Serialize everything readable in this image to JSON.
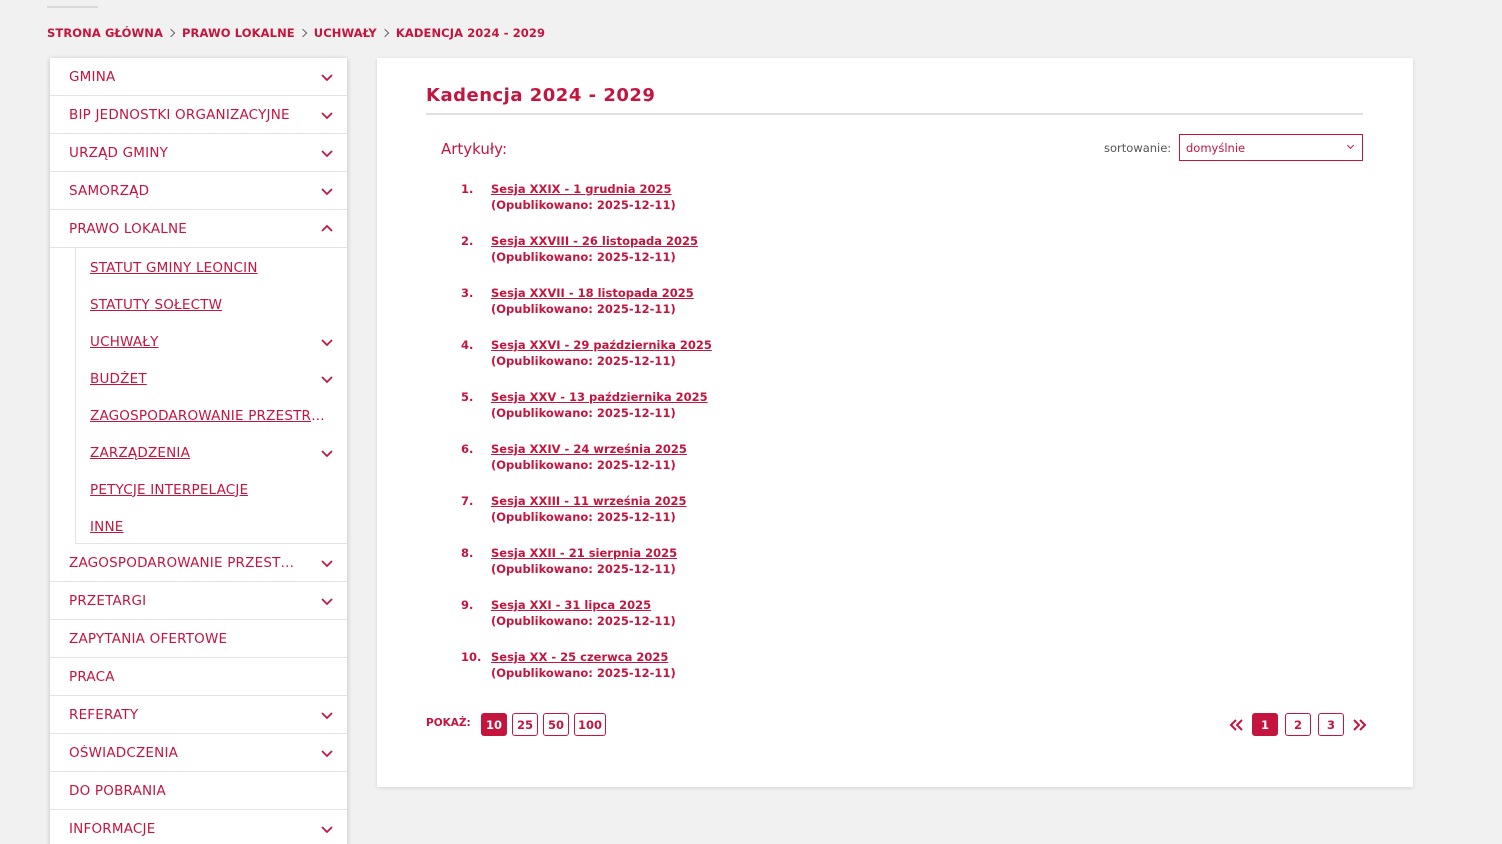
{
  "breadcrumb": [
    "STRONA GŁÓWNA",
    "PRAWO LOKALNE",
    "UCHWAŁY",
    "KADENCJA 2024 - 2029"
  ],
  "sidebar": {
    "items_top": [
      {
        "label": "GMINA",
        "chevron": "down"
      },
      {
        "label": "BIP JEDNOSTKI ORGANIZACYJNE",
        "chevron": "down"
      },
      {
        "label": "URZĄD GMINY",
        "chevron": "down"
      },
      {
        "label": "SAMORZĄD",
        "chevron": "down"
      },
      {
        "label": "PRAWO LOKALNE",
        "chevron": "up"
      }
    ],
    "subitems": [
      {
        "label": "STATUT GMINY LEONCIN",
        "chevron": "none"
      },
      {
        "label": "STATUTY SOŁECTW",
        "chevron": "none"
      },
      {
        "label": "UCHWAŁY",
        "chevron": "down"
      },
      {
        "label": "BUDŻET",
        "chevron": "down"
      },
      {
        "label": "ZAGOSPODAROWANIE PRZESTRZE...",
        "chevron": "none"
      },
      {
        "label": "ZARZĄDZENIA",
        "chevron": "down"
      },
      {
        "label": "PETYCJE INTERPELACJE",
        "chevron": "none"
      },
      {
        "label": "INNE",
        "chevron": "none"
      }
    ],
    "items_bottom": [
      {
        "label": "ZAGOSPODAROWANIE PRZESTRZ...",
        "chevron": "down"
      },
      {
        "label": "PRZETARGI",
        "chevron": "down"
      },
      {
        "label": "ZAPYTANIA OFERTOWE",
        "chevron": "none"
      },
      {
        "label": "PRACA",
        "chevron": "none"
      },
      {
        "label": "REFERATY",
        "chevron": "down"
      },
      {
        "label": "OŚWIADCZENIA",
        "chevron": "down"
      },
      {
        "label": "DO POBRANIA",
        "chevron": "none"
      },
      {
        "label": "INFORMACJE",
        "chevron": "down"
      }
    ]
  },
  "main": {
    "title": "Kadencja 2024 - 2029",
    "articles_label": "Artykuły:",
    "sort_label": "sortowanie:",
    "sort_value": "domyślnie",
    "articles": [
      {
        "num": "1.",
        "title": "Sesja XXIX - 1 grudnia 2025",
        "published": "(Opublikowano: 2025-12-11)"
      },
      {
        "num": "2.",
        "title": "Sesja XXVIII - 26 listopada 2025",
        "published": "(Opublikowano: 2025-12-11)"
      },
      {
        "num": "3.",
        "title": "Sesja XXVII - 18 listopada 2025",
        "published": "(Opublikowano: 2025-12-11)"
      },
      {
        "num": "4.",
        "title": "Sesja XXVI - 29 października 2025",
        "published": "(Opublikowano: 2025-12-11)"
      },
      {
        "num": "5.",
        "title": "Sesja XXV - 13 października 2025",
        "published": "(Opublikowano: 2025-12-11)"
      },
      {
        "num": "6.",
        "title": "Sesja XXIV - 24 września 2025",
        "published": "(Opublikowano: 2025-12-11)"
      },
      {
        "num": "7.",
        "title": "Sesja XXIII - 11 września 2025",
        "published": "(Opublikowano: 2025-12-11)"
      },
      {
        "num": "8.",
        "title": "Sesja XXII - 21 sierpnia 2025",
        "published": "(Opublikowano: 2025-12-11)"
      },
      {
        "num": "9.",
        "title": "Sesja XXI - 31 lipca 2025",
        "published": "(Opublikowano: 2025-12-11)"
      },
      {
        "num": "10.",
        "title": "Sesja XX - 25 czerwca 2025",
        "published": "(Opublikowano: 2025-12-11)"
      }
    ],
    "show_label": "POKAŻ:",
    "show_options": [
      "10",
      "25",
      "50",
      "100"
    ],
    "show_active": "10",
    "pages": [
      "1",
      "2",
      "3"
    ],
    "page_active": "1"
  },
  "colors": {
    "accent": "#c4153e",
    "background": "#f1f1f1",
    "panel": "#ffffff"
  }
}
